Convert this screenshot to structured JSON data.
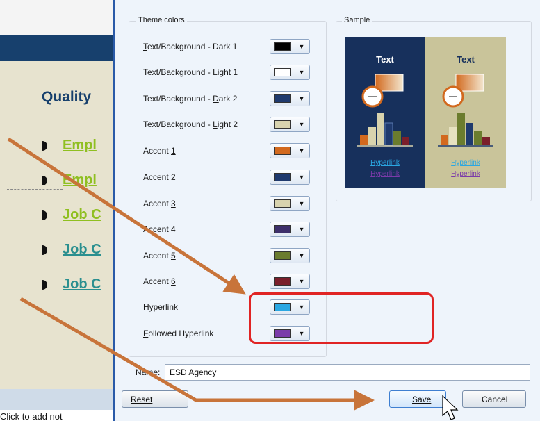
{
  "slide": {
    "title": "Quality",
    "bullets": [
      {
        "text": "Empl",
        "color": "#8fbf21"
      },
      {
        "text": "Empl",
        "color": "#8fbf21"
      },
      {
        "text": "Job C",
        "color": "#8fbf21"
      },
      {
        "text": "Job C",
        "color": "#2a8f8f"
      },
      {
        "text": "Job C",
        "color": "#2a8f8f"
      }
    ],
    "notes": "Click to add not"
  },
  "dialog": {
    "theme_colors_label": "Theme colors",
    "sample_label": "Sample",
    "colors": [
      {
        "key": "T",
        "rest": "ext/Background - Dark 1",
        "swatch": "#000000"
      },
      {
        "pre": "Text/",
        "key": "B",
        "rest": "ackground - Light 1",
        "swatch": "#ffffff"
      },
      {
        "pre": "Text/Background - ",
        "key": "D",
        "rest": "ark 2",
        "swatch": "#1f3a6e"
      },
      {
        "pre": "Text/Background - ",
        "key": "L",
        "rest": "ight 2",
        "swatch": "#d8d3ae"
      },
      {
        "pre": "Accent ",
        "key": "1",
        "rest": "",
        "swatch": "#d2691e"
      },
      {
        "pre": "Accent ",
        "key": "2",
        "rest": "",
        "swatch": "#1f3a6e"
      },
      {
        "pre": "Accent ",
        "key": "3",
        "rest": "",
        "swatch": "#d8d3ae"
      },
      {
        "pre": "Accent ",
        "key": "4",
        "rest": "",
        "swatch": "#3d2f6b"
      },
      {
        "pre": "Accent ",
        "key": "5",
        "rest": "",
        "swatch": "#6b7c2e"
      },
      {
        "pre": "Accent ",
        "key": "6",
        "rest": "",
        "swatch": "#7a1f2b"
      },
      {
        "key": "H",
        "rest": "yperlink",
        "swatch": "#2aa7e2"
      },
      {
        "key": "F",
        "rest": "ollowed Hyperlink",
        "swatch": "#7b3aa9"
      }
    ],
    "sample": {
      "text": "Text",
      "hyperlink": "Hyperlink",
      "followed_hyperlink": "Hyperlink",
      "dark_bg": "#17305c",
      "light_bg": "#c9c49a",
      "accents": [
        "#d2691e",
        "#d8d3ae",
        "#1f3a6e",
        "#6b7c2e",
        "#7a1f2b"
      ]
    },
    "name_label": "Name:",
    "name_value": "ESD Agency",
    "buttons": {
      "reset": "Reset",
      "save": "Save",
      "cancel": "Cancel"
    }
  },
  "annotation_color": "#c8743a",
  "highlight_color": "#e02424"
}
